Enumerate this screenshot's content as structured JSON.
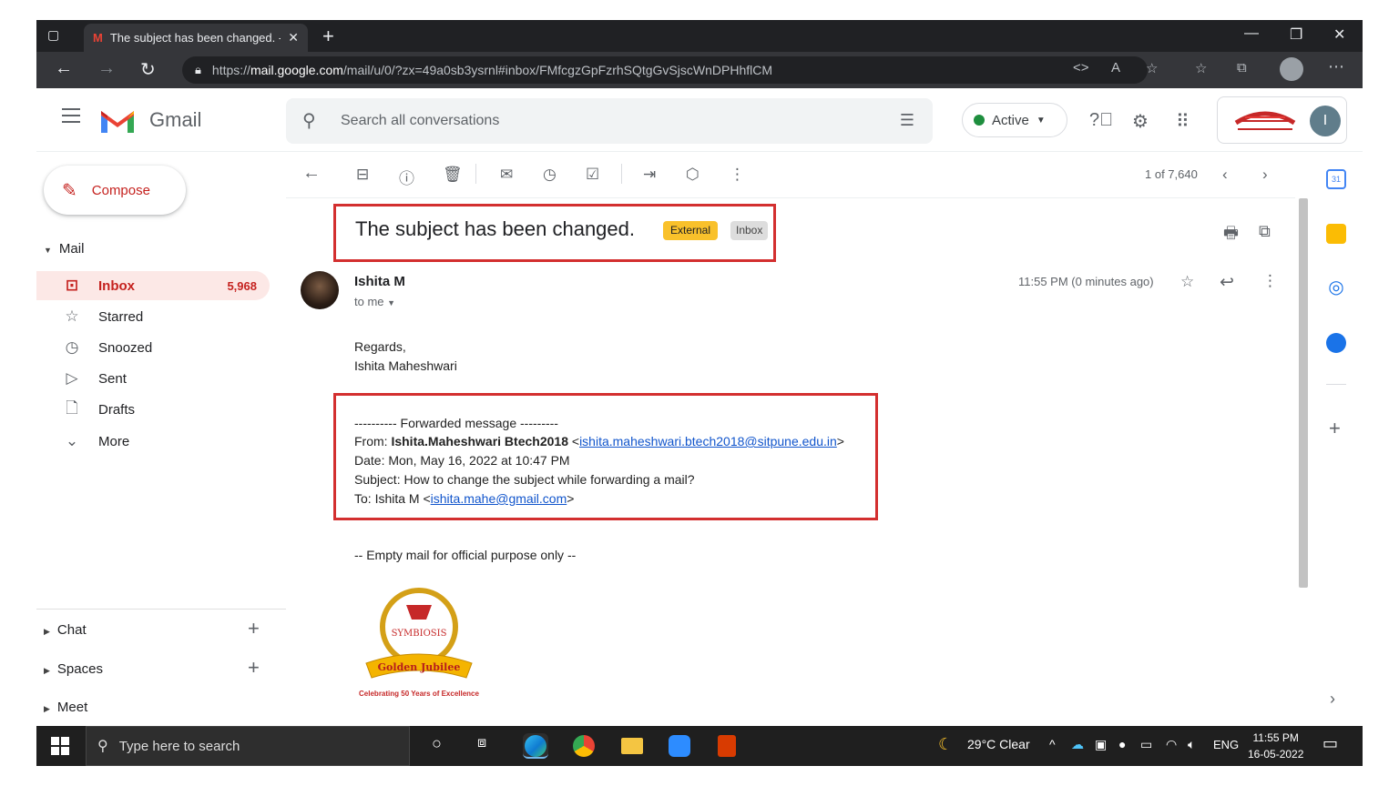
{
  "browser": {
    "tab_title": "The subject has been changed. -",
    "url_prefix": "https://",
    "url_host": "mail.google.com",
    "url_path": "/mail/u/0/?zx=49a0sb3ysrnl#inbox/FMfcgzGpFzrhSQtgGvSjscWnDPHhflCM"
  },
  "header": {
    "app_name": "Gmail",
    "search_placeholder": "Search all conversations",
    "status": "Active",
    "user_initial": "I"
  },
  "sidebar": {
    "compose_label": "Compose",
    "mail_section": "Mail",
    "items": [
      {
        "label": "Inbox",
        "count": "5,968",
        "icon": "inbox-icon"
      },
      {
        "label": "Starred",
        "icon": "star-icon"
      },
      {
        "label": "Snoozed",
        "icon": "clock-icon"
      },
      {
        "label": "Sent",
        "icon": "send-icon"
      },
      {
        "label": "Drafts",
        "icon": "draft-icon"
      },
      {
        "label": "More",
        "icon": "chevron-down-icon"
      }
    ],
    "chat_section": "Chat",
    "spaces_section": "Spaces",
    "meet_section": "Meet"
  },
  "toolbar": {
    "pager": "1 of 7,640"
  },
  "email": {
    "subject": "The subject has been changed.",
    "label_external": "External",
    "label_inbox": "Inbox",
    "sender_name": "Ishita M",
    "to_me": "to me",
    "timestamp": "11:55 PM (0 minutes ago)",
    "regards": "Regards,",
    "signature_name": "Ishita Maheshwari",
    "forwarded_header": "---------- Forwarded message ---------",
    "from_label": "From:",
    "from_name": "Ishita.Maheshwari Btech2018",
    "from_email": "ishita.maheshwari.btech2018@sitpune.edu.in",
    "date_line": "Date: Mon, May 16, 2022 at 10:47 PM",
    "subject_line": "Subject: How to change the subject while forwarding a mail?",
    "to_label": "To: Ishita M <",
    "to_email": "ishita.mahe@gmail.com",
    "footer_note": "-- Empty mail for official purpose only --",
    "logo_name": "SYMBIOSIS",
    "logo_banner": "Golden Jubilee",
    "logo_caption": "Celebrating 50 Years of Excellence"
  },
  "taskbar": {
    "search_placeholder": "Type here to search",
    "weather": "29°C  Clear",
    "language": "ENG",
    "time": "11:55 PM",
    "date": "16-05-2022"
  },
  "colors": {
    "highlight_red": "#d32f2f",
    "inbox_active_bg": "#fce8e6",
    "inbox_active_text": "#c5221f",
    "external_label": "#f9c12b",
    "active_green": "#1e8e3e"
  }
}
